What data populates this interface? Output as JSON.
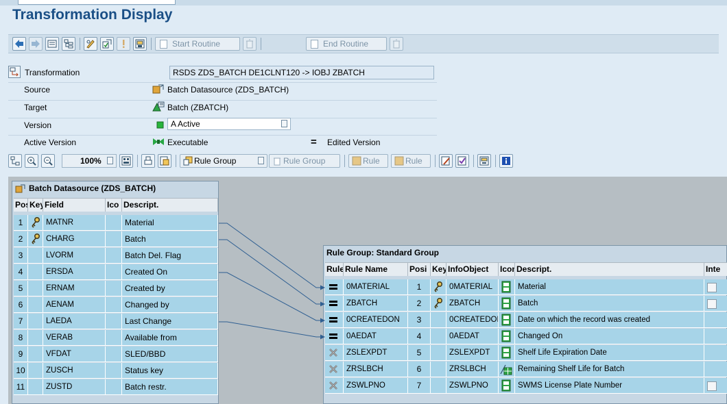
{
  "window": {
    "title": "Transformation Display"
  },
  "toolbar": {
    "start_routine": "Start Routine",
    "end_routine": "End Routine"
  },
  "header": {
    "transformation_label": "Transformation",
    "transformation_value": "RSDS ZDS_BATCH DE1CLNT120 -> IOBJ ZBATCH",
    "source_label": "Source",
    "source_value": "Batch Datasource (ZDS_BATCH)",
    "target_label": "Target",
    "target_value": "Batch (ZBATCH)",
    "version_label": "Version",
    "version_value": "A Active",
    "active_version_label": "Active Version",
    "active_version_value": "Executable",
    "edited_version_label": "Edited Version"
  },
  "toolbar2": {
    "zoom": "100%",
    "rule_group_add": "Rule Group",
    "rule_group_del": "Rule Group",
    "rule_add": "Rule",
    "rule_del": "Rule"
  },
  "source_panel": {
    "title": "Batch Datasource (ZDS_BATCH)",
    "columns": [
      "Posi",
      "Key",
      "Field",
      "Ico",
      "Descript."
    ],
    "rows": [
      {
        "pos": "1",
        "key": true,
        "field": "MATNR",
        "desc": "Material"
      },
      {
        "pos": "2",
        "key": true,
        "field": "CHARG",
        "desc": "Batch"
      },
      {
        "pos": "3",
        "key": false,
        "field": "LVORM",
        "desc": "Batch Del. Flag"
      },
      {
        "pos": "4",
        "key": false,
        "field": "ERSDA",
        "desc": "Created On"
      },
      {
        "pos": "5",
        "key": false,
        "field": "ERNAM",
        "desc": "Created by"
      },
      {
        "pos": "6",
        "key": false,
        "field": "AENAM",
        "desc": "Changed by"
      },
      {
        "pos": "7",
        "key": false,
        "field": "LAEDA",
        "desc": "Last Change"
      },
      {
        "pos": "8",
        "key": false,
        "field": "VERAB",
        "desc": "Available from"
      },
      {
        "pos": "9",
        "key": false,
        "field": "VFDAT",
        "desc": "SLED/BBD"
      },
      {
        "pos": "10",
        "key": false,
        "field": "ZUSCH",
        "desc": "Status key"
      },
      {
        "pos": "11",
        "key": false,
        "field": "ZUSTD",
        "desc": "Batch restr."
      }
    ]
  },
  "rule_panel": {
    "title": "Rule Group: Standard Group",
    "columns": [
      "Rule",
      "Rule Name",
      "Posi",
      "Key",
      "InfoObject",
      "Icon",
      "Descript.",
      "Inte"
    ],
    "rows": [
      {
        "rule": "equals",
        "name": "0MATERIAL",
        "pos": "1",
        "key": true,
        "infoobject": "0MATERIAL",
        "icon": "char",
        "desc": "Material",
        "check": true
      },
      {
        "rule": "equals",
        "name": "ZBATCH",
        "pos": "2",
        "key": true,
        "infoobject": "ZBATCH",
        "icon": "char",
        "desc": "Batch",
        "check": true
      },
      {
        "rule": "equals",
        "name": "0CREATEDON",
        "pos": "3",
        "key": false,
        "infoobject": "0CREATEDON",
        "icon": "char",
        "desc": "Date on which the record was created",
        "check": false
      },
      {
        "rule": "equals",
        "name": "0AEDAT",
        "pos": "4",
        "key": false,
        "infoobject": "0AEDAT",
        "icon": "char",
        "desc": "Changed On",
        "check": false
      },
      {
        "rule": "none",
        "name": "ZSLEXPDT",
        "pos": "5",
        "key": false,
        "infoobject": "ZSLEXPDT",
        "icon": "char",
        "desc": "Shelf Life Expiration Date",
        "check": false
      },
      {
        "rule": "none",
        "name": "ZRSLBCH",
        "pos": "6",
        "key": false,
        "infoobject": "ZRSLBCH",
        "icon": "keyfig",
        "desc": "Remaining Shelf Life for Batch",
        "check": false
      },
      {
        "rule": "none",
        "name": "ZSWLPNO",
        "pos": "7",
        "key": false,
        "infoobject": "ZSWLPNO",
        "icon": "char",
        "desc": "SWMS License Plate Number",
        "check": true
      }
    ]
  },
  "colors": {
    "title": "#1a4f86",
    "row_bg": "#a7d4e8",
    "canvas": "#b6bec3",
    "link": "#2f5f92"
  }
}
